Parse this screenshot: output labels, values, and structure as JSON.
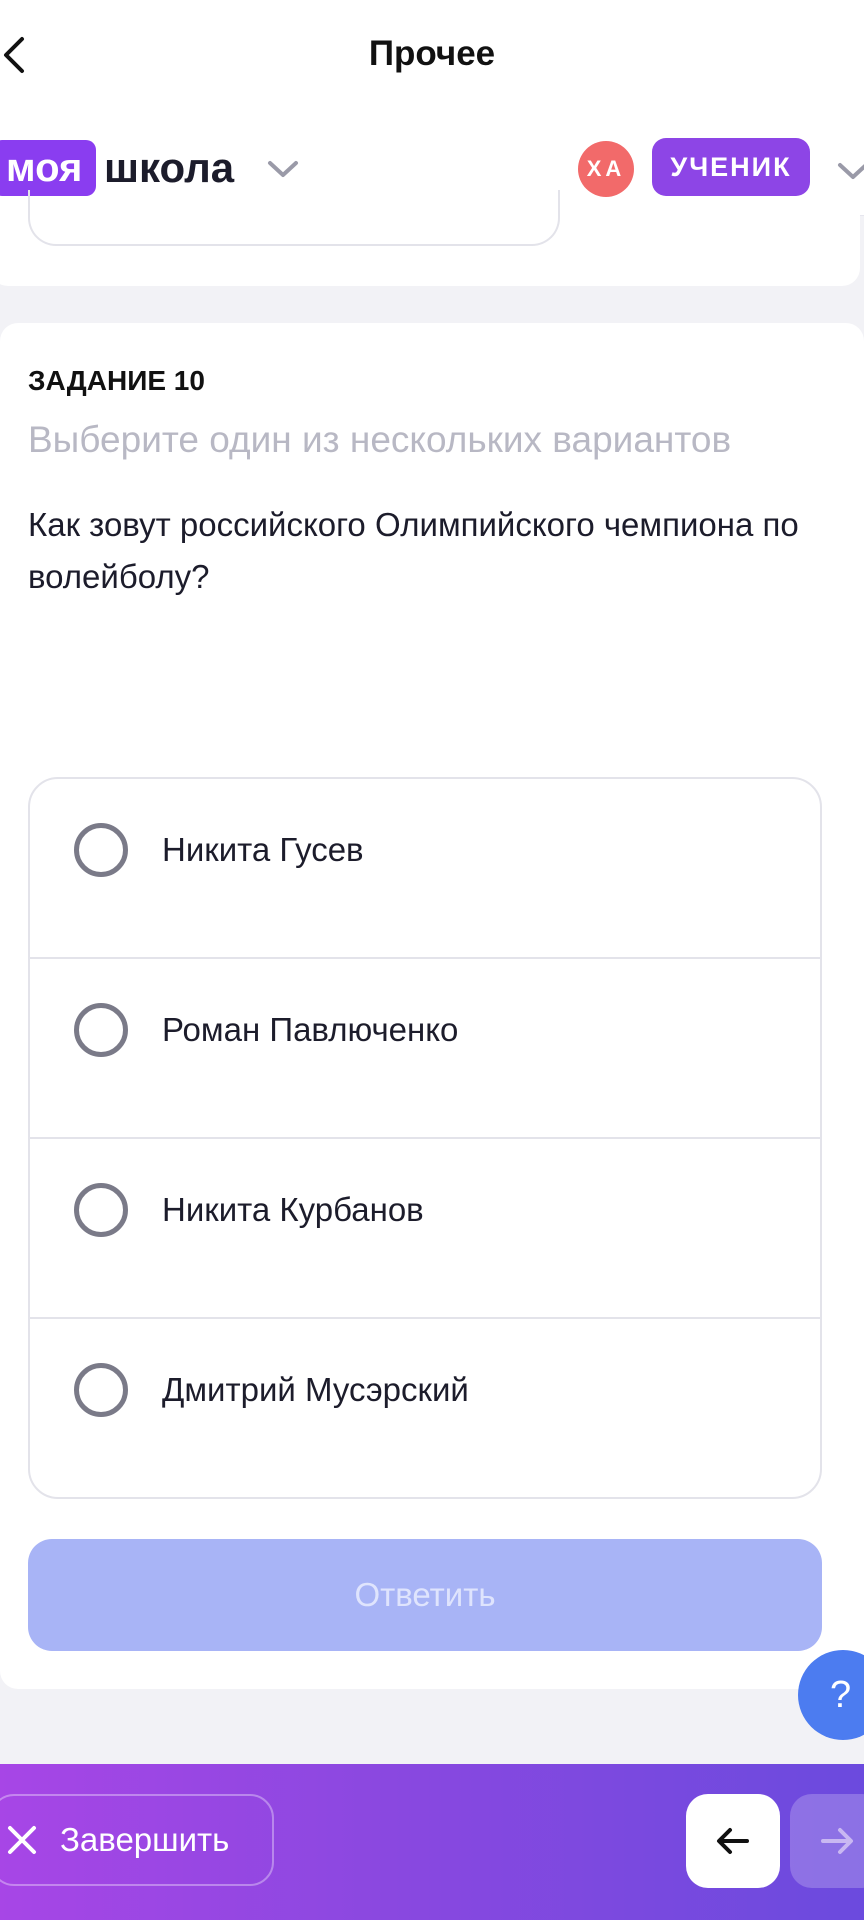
{
  "header": {
    "title": "Прочее",
    "back_icon": "chevron-left-icon"
  },
  "brand": {
    "logo_part1": "моя",
    "logo_part2": "школа",
    "avatar_initials": "ХА",
    "role": "УЧЕНИК"
  },
  "task": {
    "number": "ЗАДАНИЕ 10",
    "hint": "Выберите один из нескольких вариантов",
    "question": "Как зовут российского Олимпийского чемпиона по волейболу?",
    "options": [
      {
        "label": "Никита Гусев"
      },
      {
        "label": "Роман Павлюченко"
      },
      {
        "label": "Никита Курбанов"
      },
      {
        "label": "Дмитрий Мусэрский"
      }
    ],
    "submit_label": "Ответить"
  },
  "help": {
    "label": "?"
  },
  "footer": {
    "finish_label": "Завершить",
    "prev_icon": "arrow-left-icon",
    "next_icon": "arrow-right-icon"
  },
  "colors": {
    "brand_purple": "#8a3df0",
    "avatar_red": "#f26a6a",
    "submit_disabled": "#a8b4f6",
    "help_blue": "#4c7cf0"
  }
}
